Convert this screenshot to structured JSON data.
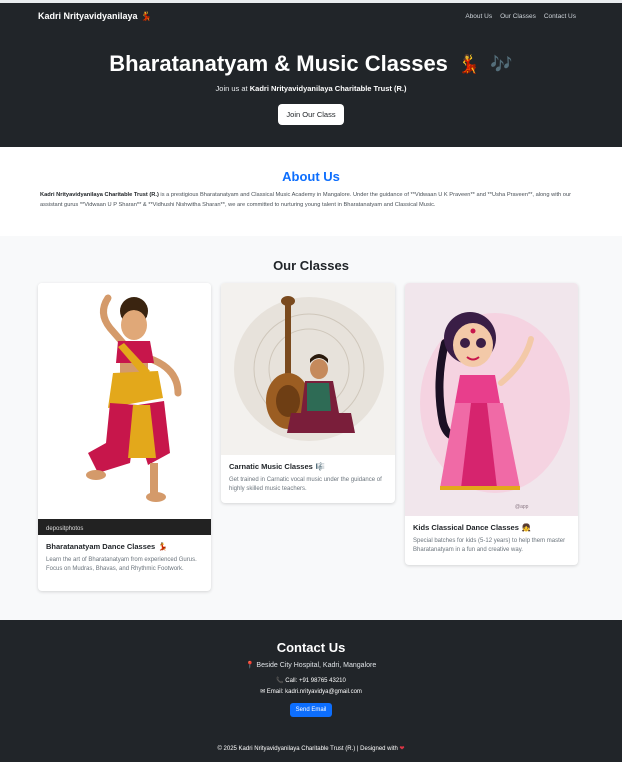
{
  "nav": {
    "brand": "Kadri Nrityavidyanilaya",
    "brand_emoji": "💃",
    "links": [
      "About Us",
      "Our Classes",
      "Contact Us"
    ]
  },
  "hero": {
    "title": "Bharatanatyam & Music Classes",
    "title_emoji_1": "💃",
    "title_emoji_2": "🎶",
    "sub_prefix": "Join us at",
    "sub_strong": "Kadri Nrityavidyanilaya Charitable Trust (R.)",
    "button": "Join Our Class"
  },
  "about": {
    "heading": "About Us",
    "strong": "Kadri Nrityavidyanilaya Charitable Trust (R.)",
    "text": " is a prestigious Bharatanatyam and Classical Music Academy in Mangalore. Under the guidance of **Vidwaan U K Praveen** and **Usha Praveen**, along with our assistant gurus **Vidwaan U P Sharan** & **Vidhushi Nishwitha Sharan**, we are committed to nurturing young talent in Bharatanatyam and Classical Music."
  },
  "classes": {
    "heading": "Our Classes",
    "cards": [
      {
        "title": "Bharatanatyam Dance Classes",
        "emoji": "💃",
        "desc": "Learn the art of Bharatanatyam from experienced Gurus. Focus on Mudras, Bhavas, and Rhythmic Footwork.",
        "image_watermark": "depositphotos"
      },
      {
        "title": "Carnatic Music Classes",
        "emoji": "🎼",
        "desc": "Get trained in Carnatic vocal music under the guidance of highly skilled music teachers."
      },
      {
        "title": "Kids Classical Dance Classes",
        "emoji": "👧",
        "desc": "Special batches for kids (5-12 years) to help them master Bharatanatyam in a fun and creative way."
      }
    ]
  },
  "contact": {
    "heading": "Contact Us",
    "address": "Beside City Hospital, Kadri, Mangalore",
    "call": "Call: +91 98765 43210",
    "email": "Email: kadri.nrityavidya@gmail.com",
    "button": "Send Email",
    "footer": "© 2025 Kadri Nrityavidyanilaya Charitable Trust (R.) | Designed with",
    "footer_heart": "❤"
  },
  "colors": {
    "dark": "#212529",
    "accent": "#0d6efd",
    "light_bg": "#f8f9fa"
  }
}
